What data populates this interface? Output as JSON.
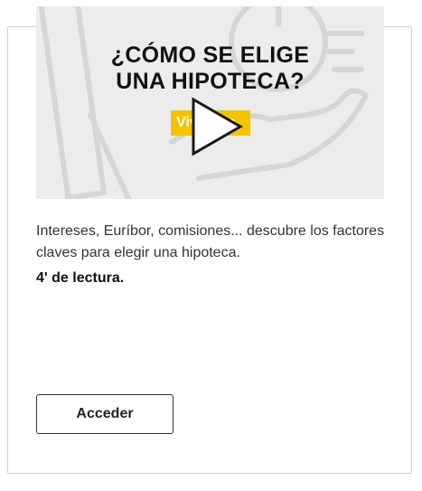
{
  "thumbnail": {
    "title_line1": "¿CÓMO SE ELIGE",
    "title_line2": "UNA HIPOTECA?",
    "tag_label": "Vivienda",
    "tag_color": "#f3c300",
    "play_icon": "play-icon"
  },
  "card": {
    "description": "Intereses, Euríbor, comisiones... descubre los factores claves para elegir una hipoteca.",
    "reading_time": "4' de lectura.",
    "button_label": "Acceder"
  }
}
